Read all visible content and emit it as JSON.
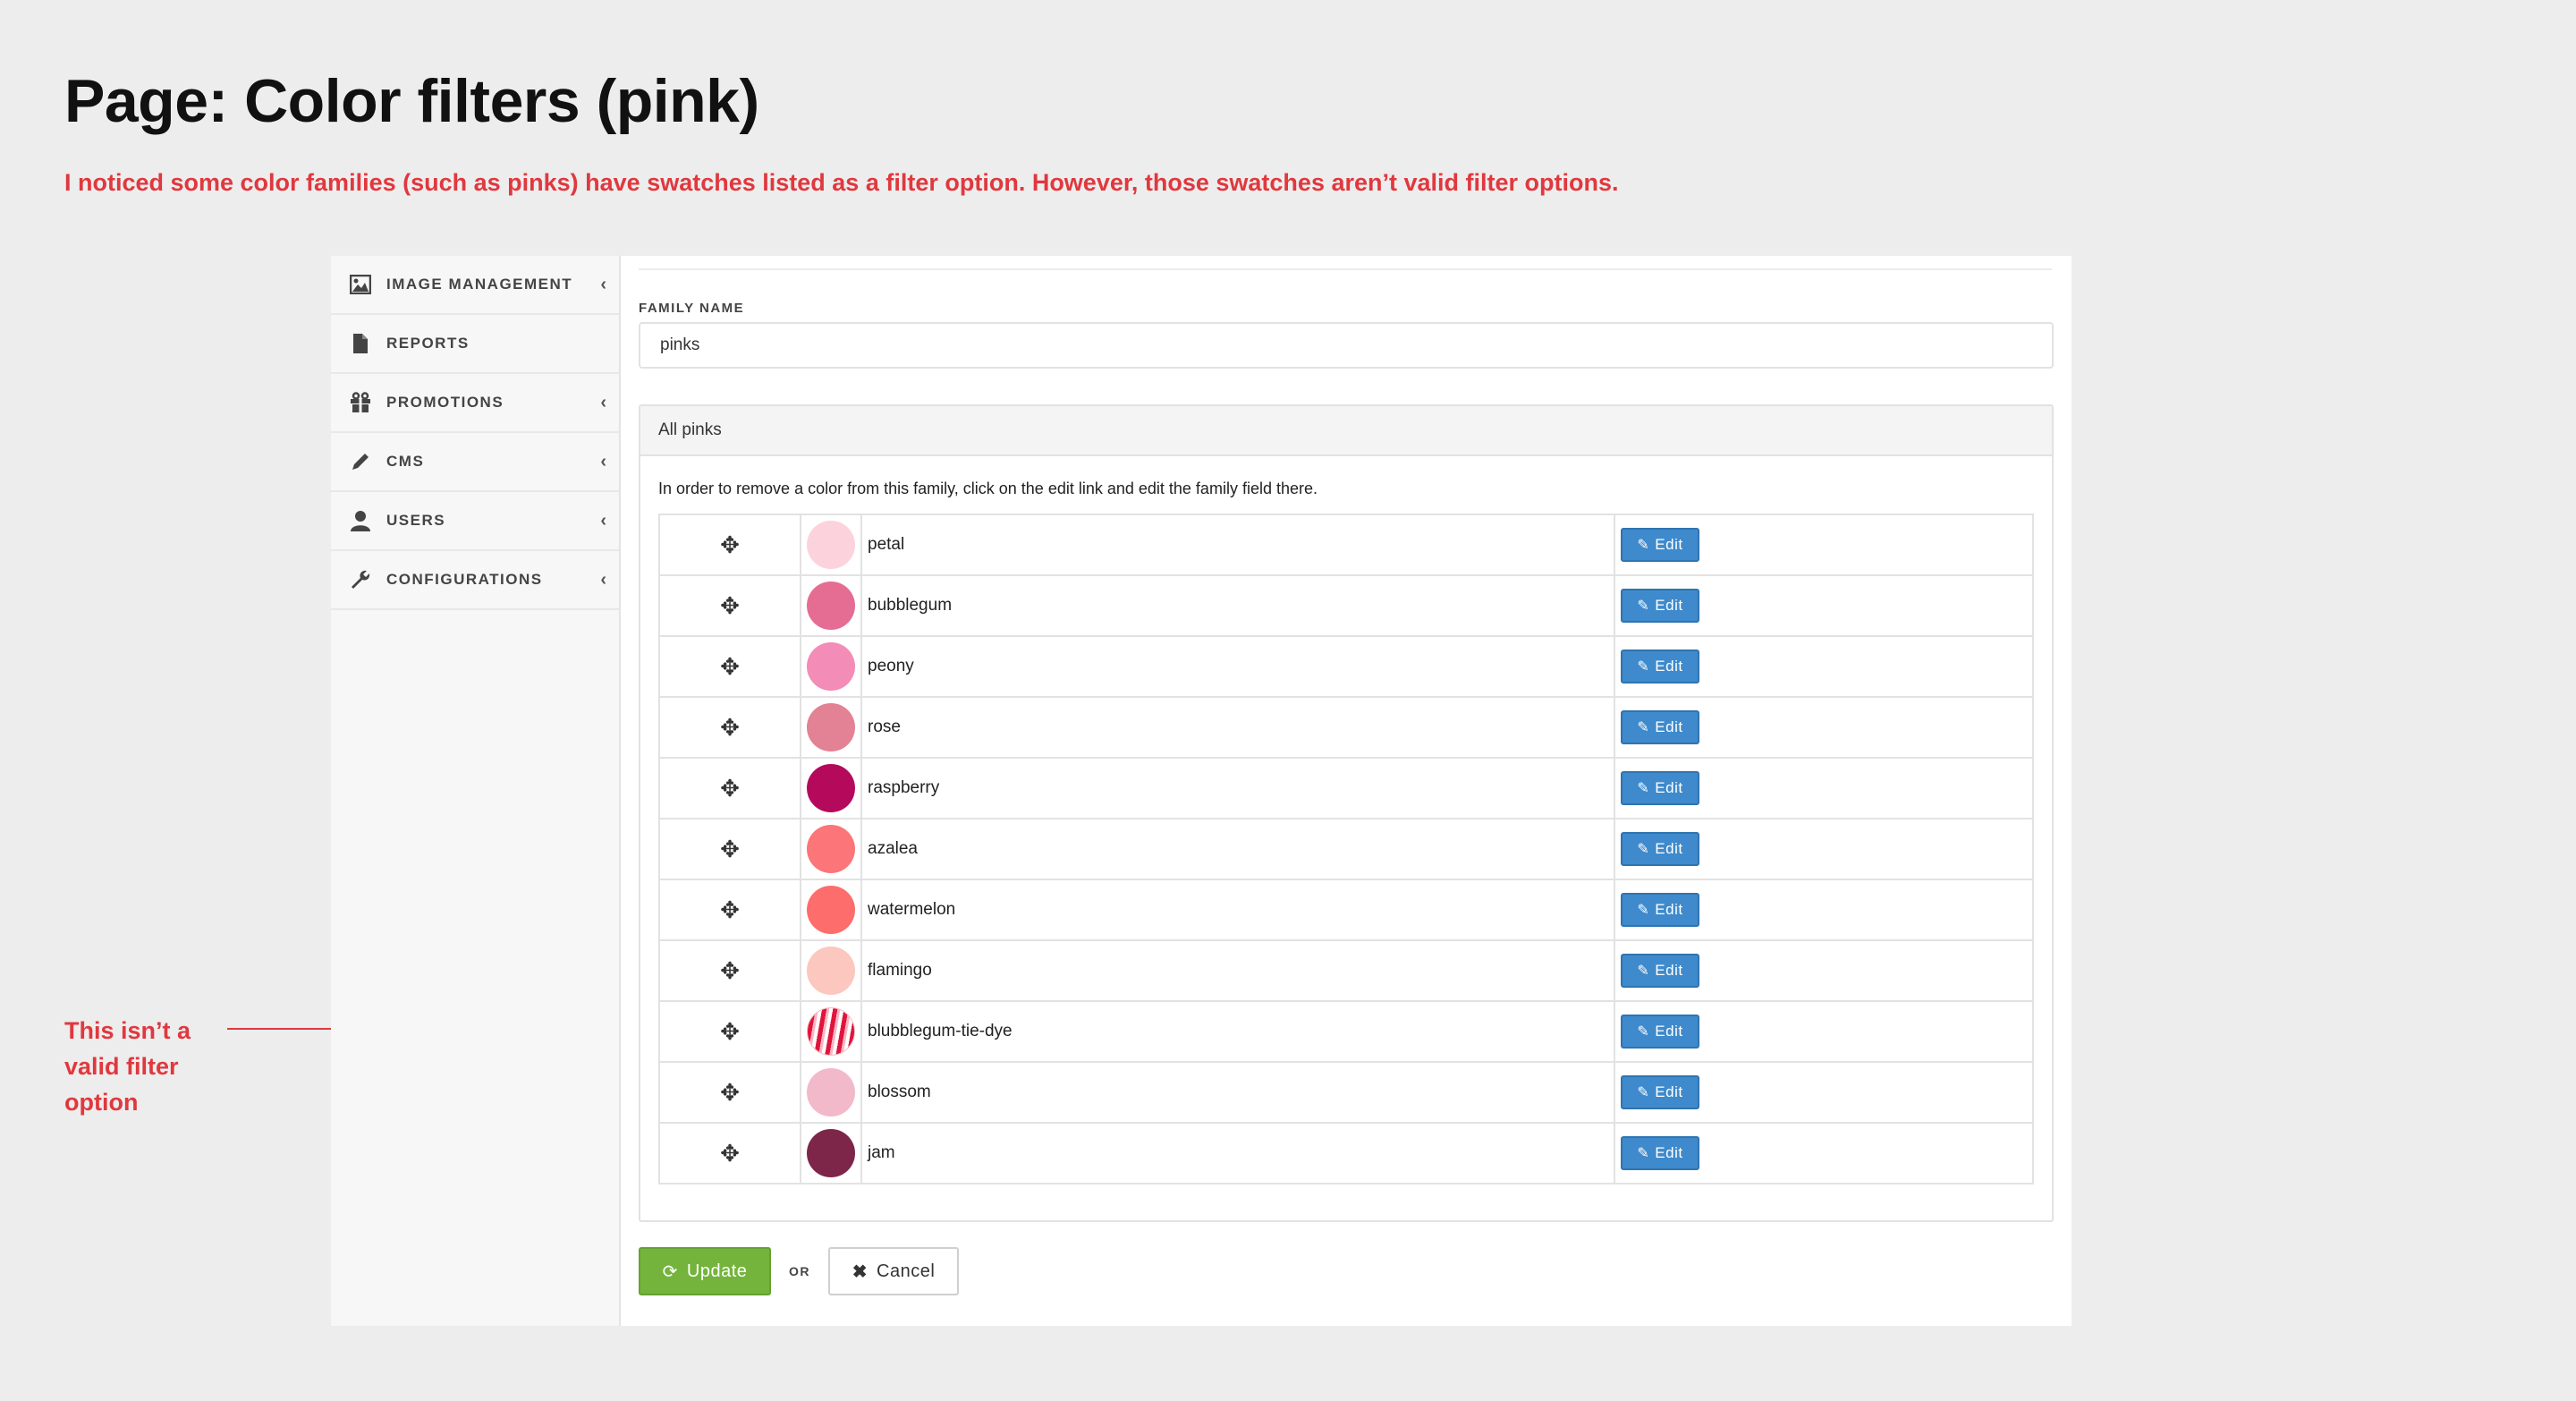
{
  "doc": {
    "title": "Page: Color filters (pink)",
    "subtitle": "I noticed some color families (such as pinks) have swatches listed as a filter option. However, those swatches aren’t valid filter options.",
    "annotation": "This isn’t a\nvalid filter\noption",
    "accent_color": "#e0383e"
  },
  "sidebar": {
    "items": [
      {
        "label": "IMAGE MANAGEMENT",
        "icon": "image-icon",
        "has_chevron": true
      },
      {
        "label": "REPORTS",
        "icon": "file-icon",
        "has_chevron": false
      },
      {
        "label": "PROMOTIONS",
        "icon": "gift-icon",
        "has_chevron": true
      },
      {
        "label": "CMS",
        "icon": "pencil-icon",
        "has_chevron": true
      },
      {
        "label": "USERS",
        "icon": "user-icon",
        "has_chevron": true
      },
      {
        "label": "CONFIGURATIONS",
        "icon": "wrench-icon",
        "has_chevron": true
      }
    ]
  },
  "form": {
    "family_name_label": "FAMILY NAME",
    "family_name_value": "pinks",
    "panel_title": "All pinks",
    "panel_note": "In order to remove a color from this family, click on the edit link and edit the family field there.",
    "edit_label": "Edit",
    "update_label": "Update",
    "or_label": "OR",
    "cancel_label": "Cancel",
    "update_color": "#74b43c",
    "edit_color": "#3e8acc"
  },
  "colors": [
    {
      "name": "petal",
      "hex": "#fcd3dc"
    },
    {
      "name": "bubblegum",
      "hex": "#e56d94"
    },
    {
      "name": "peony",
      "hex": "#f38cb6"
    },
    {
      "name": "rose",
      "hex": "#e28294"
    },
    {
      "name": "raspberry",
      "hex": "#b5095c"
    },
    {
      "name": "azalea",
      "hex": "#fb7579"
    },
    {
      "name": "watermelon",
      "hex": "#fd6d6c"
    },
    {
      "name": "flamingo",
      "hex": "#fbc7be"
    },
    {
      "name": "blubblegum-tie-dye",
      "hex": "tie-dye"
    },
    {
      "name": "blossom",
      "hex": "#f2b9cb"
    },
    {
      "name": "jam",
      "hex": "#7d2649"
    }
  ]
}
